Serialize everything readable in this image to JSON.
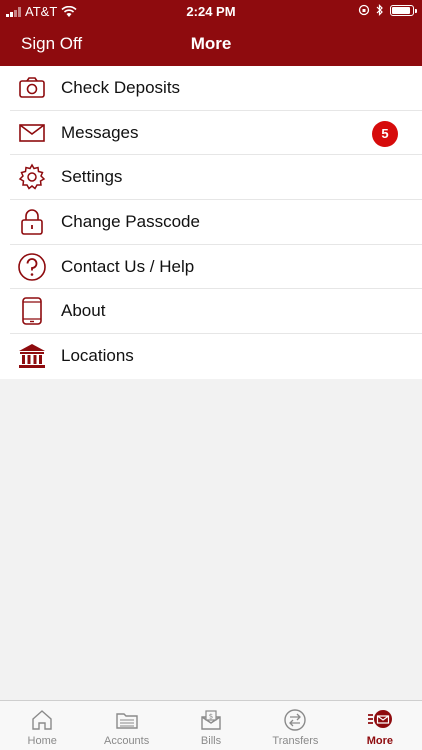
{
  "status_bar": {
    "carrier": "AT&T",
    "time": "2:24 PM"
  },
  "nav": {
    "left_button": "Sign Off",
    "title": "More"
  },
  "menu": {
    "items": [
      {
        "label": "Check Deposits",
        "icon": "camera-icon"
      },
      {
        "label": "Messages",
        "icon": "envelope-icon",
        "badge": "5"
      },
      {
        "label": "Settings",
        "icon": "gear-icon"
      },
      {
        "label": "Change Passcode",
        "icon": "lock-icon"
      },
      {
        "label": "Contact Us / Help",
        "icon": "help-icon"
      },
      {
        "label": "About",
        "icon": "phone-icon"
      },
      {
        "label": "Locations",
        "icon": "bank-icon"
      }
    ]
  },
  "tabs": [
    {
      "label": "Home",
      "icon": "home-icon"
    },
    {
      "label": "Accounts",
      "icon": "accounts-icon"
    },
    {
      "label": "Bills",
      "icon": "bills-icon"
    },
    {
      "label": "Transfers",
      "icon": "transfers-icon"
    },
    {
      "label": "More",
      "icon": "more-icon",
      "active": true
    }
  ],
  "colors": {
    "brand": "#8e0b0e",
    "badge": "#d60b0b"
  }
}
